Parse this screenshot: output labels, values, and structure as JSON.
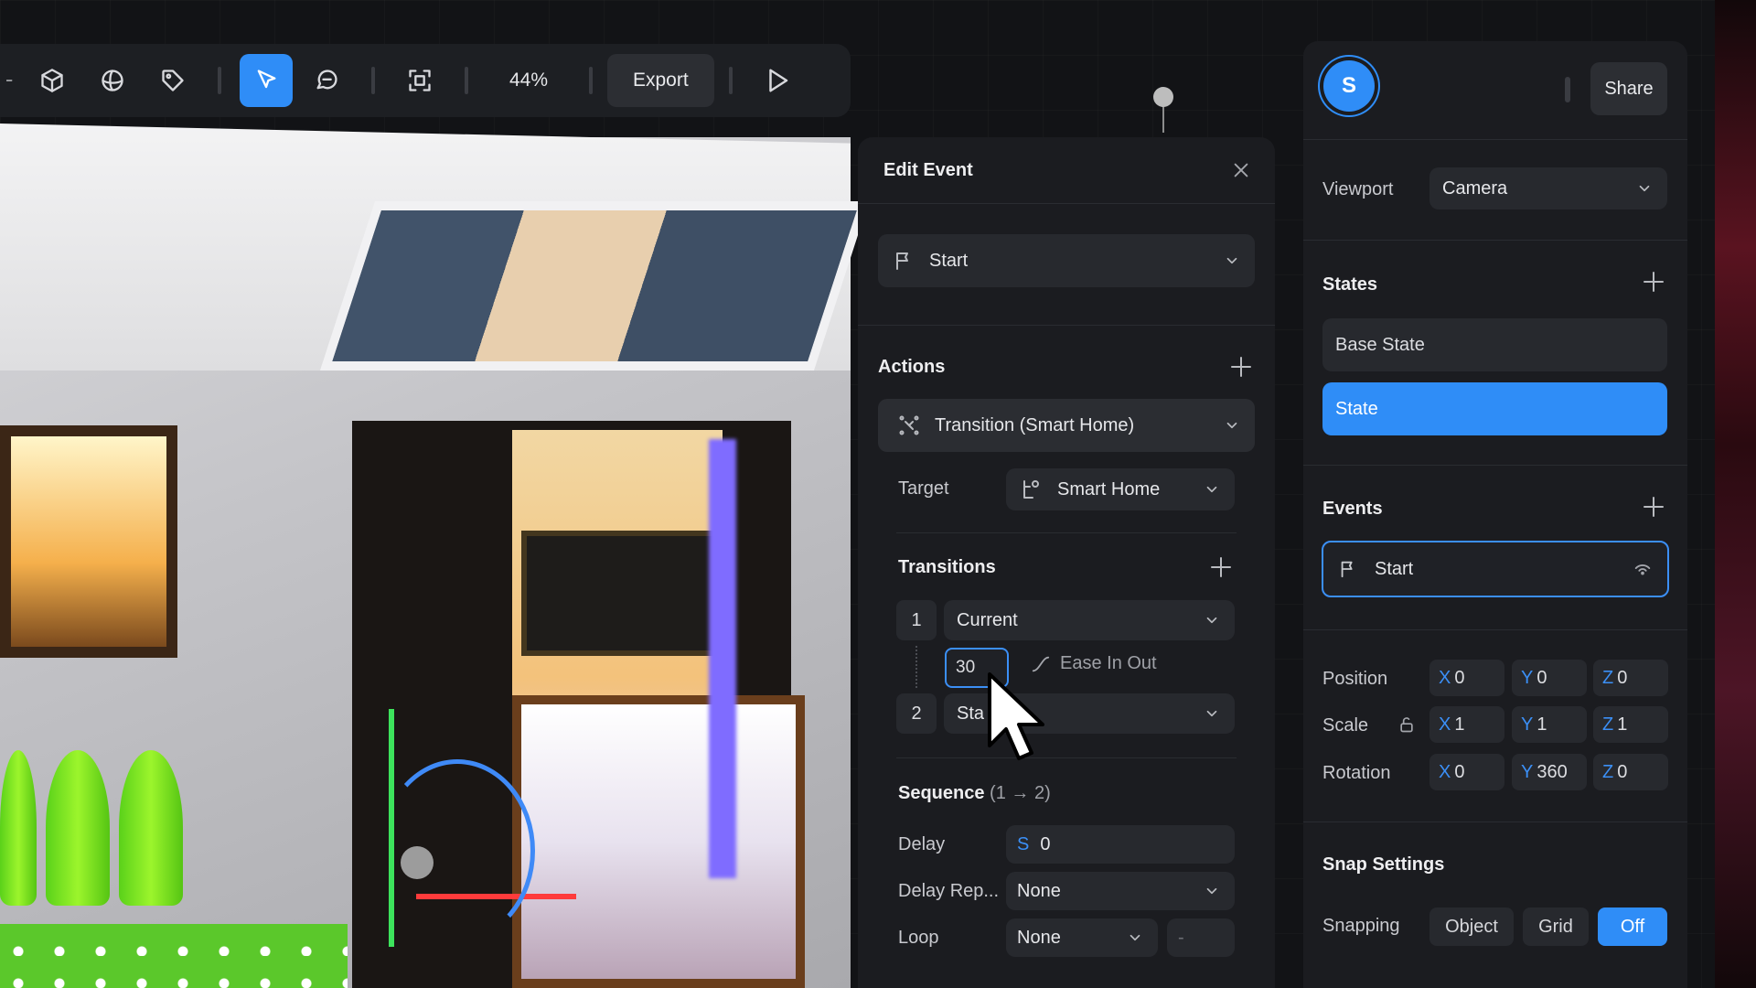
{
  "toolbar": {
    "zoom": "44%",
    "export_label": "Export",
    "tools": [
      "minus-icon",
      "cube-icon",
      "sphere-icon",
      "tag-icon",
      "pointer-icon",
      "comment-icon",
      "frame-icon",
      "play-icon"
    ],
    "active_tool": "pointer-icon"
  },
  "edit_event": {
    "title": "Edit Event",
    "trigger": "Start",
    "actions_title": "Actions",
    "action": "Transition (Smart Home)",
    "target_label": "Target",
    "target_value": "Smart Home",
    "transitions_title": "Transitions",
    "transitions": [
      {
        "index": "1",
        "state": "Current"
      },
      {
        "index": "2",
        "state": "Sta"
      }
    ],
    "duration": "30",
    "easing": "Ease In Out",
    "sequence_title": "Sequence",
    "sequence_range": "(1 → 2)",
    "delay_label": "Delay",
    "delay_unit": "S",
    "delay_value": "0",
    "delay_repeat_label": "Delay Rep...",
    "delay_repeat_value": "None",
    "loop_label": "Loop",
    "loop_value": "None",
    "loop_extra": "-"
  },
  "properties": {
    "avatar_letter": "S",
    "share_label": "Share",
    "viewport_label": "Viewport",
    "viewport_value": "Camera",
    "states_title": "States",
    "states": [
      "Base State",
      "State"
    ],
    "active_state": "State",
    "events_title": "Events",
    "event": "Start",
    "position_label": "Position",
    "scale_label": "Scale",
    "rotation_label": "Rotation",
    "position": {
      "x": "0",
      "y": "0",
      "z": "0"
    },
    "scale": {
      "x": "1",
      "y": "1",
      "z": "1"
    },
    "rotation": {
      "x": "0",
      "y": "360",
      "z": "0"
    },
    "axis": {
      "x": "X",
      "y": "Y",
      "z": "Z"
    },
    "snap_title": "Snap Settings",
    "snapping_label": "Snapping",
    "snap_options": [
      "Object",
      "Grid",
      "Off"
    ],
    "snap_active": "Off"
  },
  "colors": {
    "accent": "#2f8df7",
    "panel": "#1b1c20",
    "field": "#27292e"
  }
}
